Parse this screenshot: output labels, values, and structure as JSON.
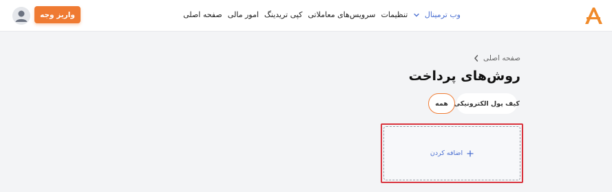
{
  "header": {
    "logo_icon": "brand-a-logo-icon",
    "nav": [
      {
        "label": "صفحه اصلی"
      },
      {
        "label": "امور مالی"
      },
      {
        "label": "کپی تریدینگ"
      },
      {
        "label": "سرویس‌های معاملاتی"
      },
      {
        "label": "تنظیمات"
      },
      {
        "label": "وب ترمینال",
        "active": true
      }
    ],
    "deposit_label": "واریز وجه",
    "avatar_icon": "user-avatar-icon"
  },
  "breadcrumb": {
    "label": "صفحه اصلی"
  },
  "page_title": "روش‌های پرداخت",
  "tabs": [
    {
      "label": "همه",
      "active": true
    },
    {
      "label": "کیف پول الکترونیکی"
    }
  ],
  "add_card": {
    "label": "اضافه کردن"
  },
  "colors": {
    "accent": "#ef7a32",
    "link": "#4a6fd1",
    "highlight": "#d9323c"
  }
}
